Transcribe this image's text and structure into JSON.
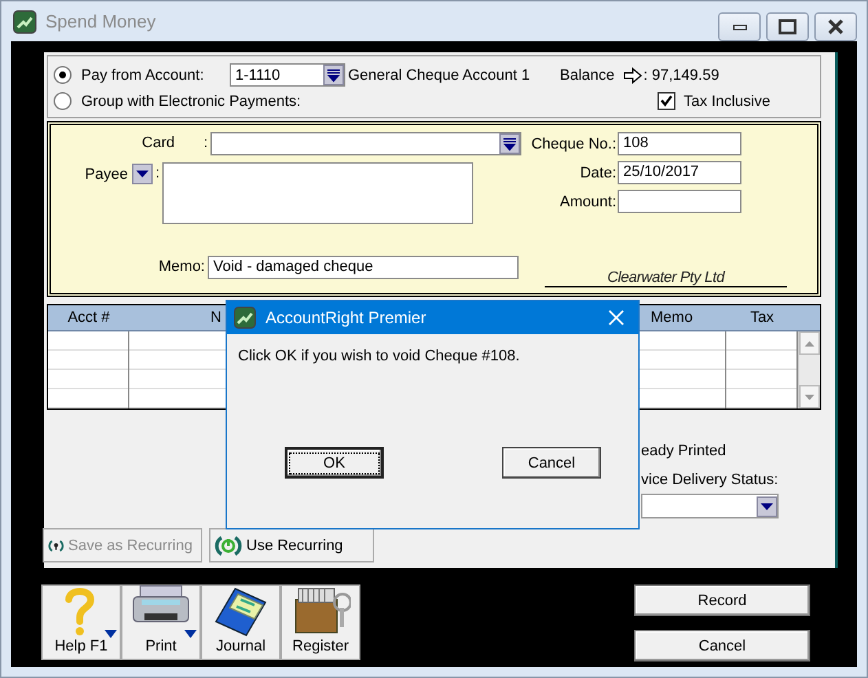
{
  "window": {
    "title": "Spend Money"
  },
  "payment_source": [
    {
      "label": "Pay from Account:",
      "selected": true
    },
    {
      "label": "Group with Electronic Payments:",
      "selected": false
    }
  ],
  "account": {
    "number": "1-1110",
    "name": "General Cheque Account 1"
  },
  "balance": {
    "label": "Balance",
    "value": ": 97,149.59"
  },
  "tax_inclusive": {
    "label": "Tax Inclusive",
    "checked": true
  },
  "card": {
    "label": "Card",
    "colon": ":"
  },
  "payee": {
    "label": "Payee",
    "colon": ":"
  },
  "cheque_no": {
    "label": "Cheque No.:",
    "value": "108"
  },
  "date": {
    "label": "Date:",
    "value": "25/10/2017"
  },
  "amount": {
    "label": "Amount:"
  },
  "memo": {
    "label": "Memo:",
    "value": "Void - damaged cheque"
  },
  "company": "Clearwater Pty Ltd",
  "table": {
    "columns": [
      "Acct #",
      "N",
      "Memo",
      "Tax"
    ]
  },
  "delivery": {
    "printed_label": "eady Printed",
    "status_label": "vice Delivery Status:"
  },
  "recurring_buttons": [
    {
      "label": "Save as Recurring",
      "kind": "save",
      "disabled": true
    },
    {
      "label": "Use Recurring",
      "kind": "use",
      "disabled": false
    }
  ],
  "toolbar": [
    {
      "label": "Help F1",
      "kind": "help",
      "menu": true
    },
    {
      "label": "Print",
      "kind": "print",
      "menu": true
    },
    {
      "label": "Journal",
      "kind": "journal",
      "menu": false
    },
    {
      "label": "Register",
      "kind": "register",
      "menu": false
    }
  ],
  "actions": [
    "Record",
    "Cancel"
  ],
  "dialog": {
    "title": "AccountRight Premier",
    "message": "Click OK if you wish to void Cheque #108.",
    "buttons": [
      {
        "label": "OK",
        "default": true
      },
      {
        "label": "Cancel",
        "default": false
      }
    ]
  }
}
